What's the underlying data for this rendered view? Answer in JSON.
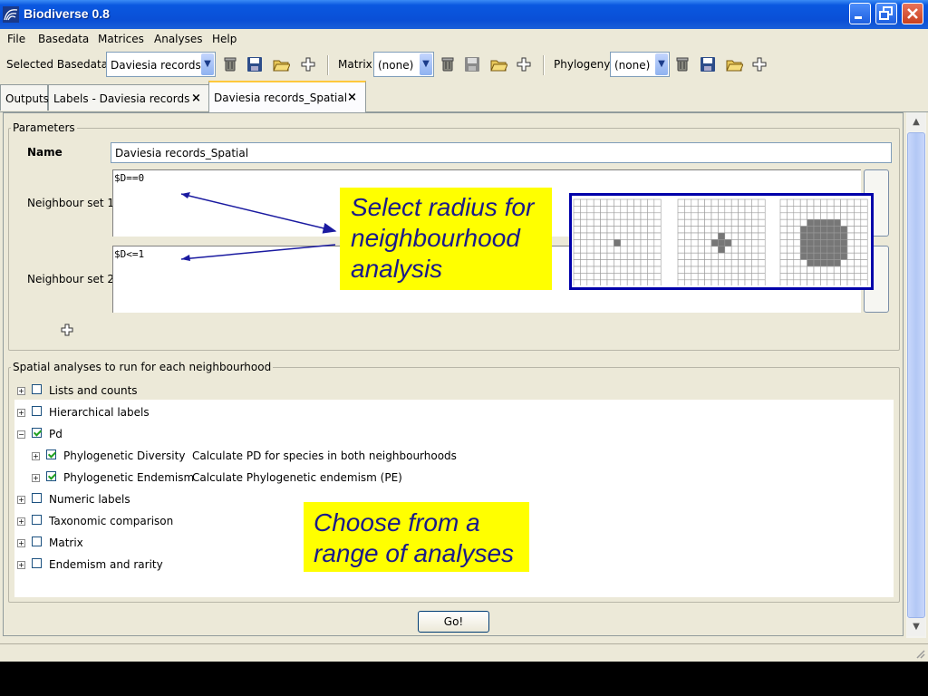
{
  "window": {
    "title": "Biodiverse 0.8"
  },
  "menu": [
    "File",
    "Basedata",
    "Matrices",
    "Analyses",
    "Help"
  ],
  "toolbar": {
    "basedata_label": "Selected Basedata",
    "basedata_value": "Daviesia records",
    "matrix_label": "Matrix",
    "matrix_value": "(none)",
    "phylogeny_label": "Phylogeny",
    "phylogeny_value": "(none)"
  },
  "tabs": [
    {
      "label": "Outputs"
    },
    {
      "label": "Labels - Daviesia records",
      "closable": true
    },
    {
      "label": "Daviesia records_Spatial",
      "closable": true,
      "active": true
    }
  ],
  "parameters": {
    "legend": "Parameters",
    "name_label": "Name",
    "name_value": "Daviesia records_Spatial",
    "neighbour_set_1_label": "Neighbour set 1",
    "neighbour_set_1_value": "$D==0",
    "neighbour_set_2_label": "Neighbour set 2",
    "neighbour_set_2_value": "$D<=1"
  },
  "analyses": {
    "legend": "Spatial analyses to run for each neighbourhood",
    "items": [
      {
        "label": "Lists and counts",
        "checked": false,
        "expanded": false
      },
      {
        "label": "Hierarchical labels",
        "checked": false,
        "expanded": false
      },
      {
        "label": "Pd",
        "checked": true,
        "expanded": true
      },
      {
        "label": "Phylogenetic Diversity",
        "desc": "Calculate PD for species in both neighbourhoods",
        "checked": true,
        "child": true
      },
      {
        "label": "Phylogenetic Endemism",
        "desc": "Calculate Phylogenetic endemism (PE)",
        "checked": true,
        "child": true
      },
      {
        "label": "Numeric labels",
        "checked": false,
        "expanded": false
      },
      {
        "label": "Taxonomic comparison",
        "checked": false,
        "expanded": false
      },
      {
        "label": "Matrix",
        "checked": false,
        "expanded": false
      },
      {
        "label": "Endemism and rarity",
        "checked": false,
        "expanded": false
      }
    ]
  },
  "go_button": "Go!",
  "callouts": {
    "radius": [
      "Select radius for",
      "neighbourhood",
      "analysis"
    ],
    "analyses": [
      "Choose from a",
      "range of analyses"
    ]
  },
  "colors": {
    "callout_bg": "#ffff00",
    "callout_text": "#1a1a8a",
    "titlebar": "#0a4fd6",
    "arrow": "#1a1aa0"
  }
}
